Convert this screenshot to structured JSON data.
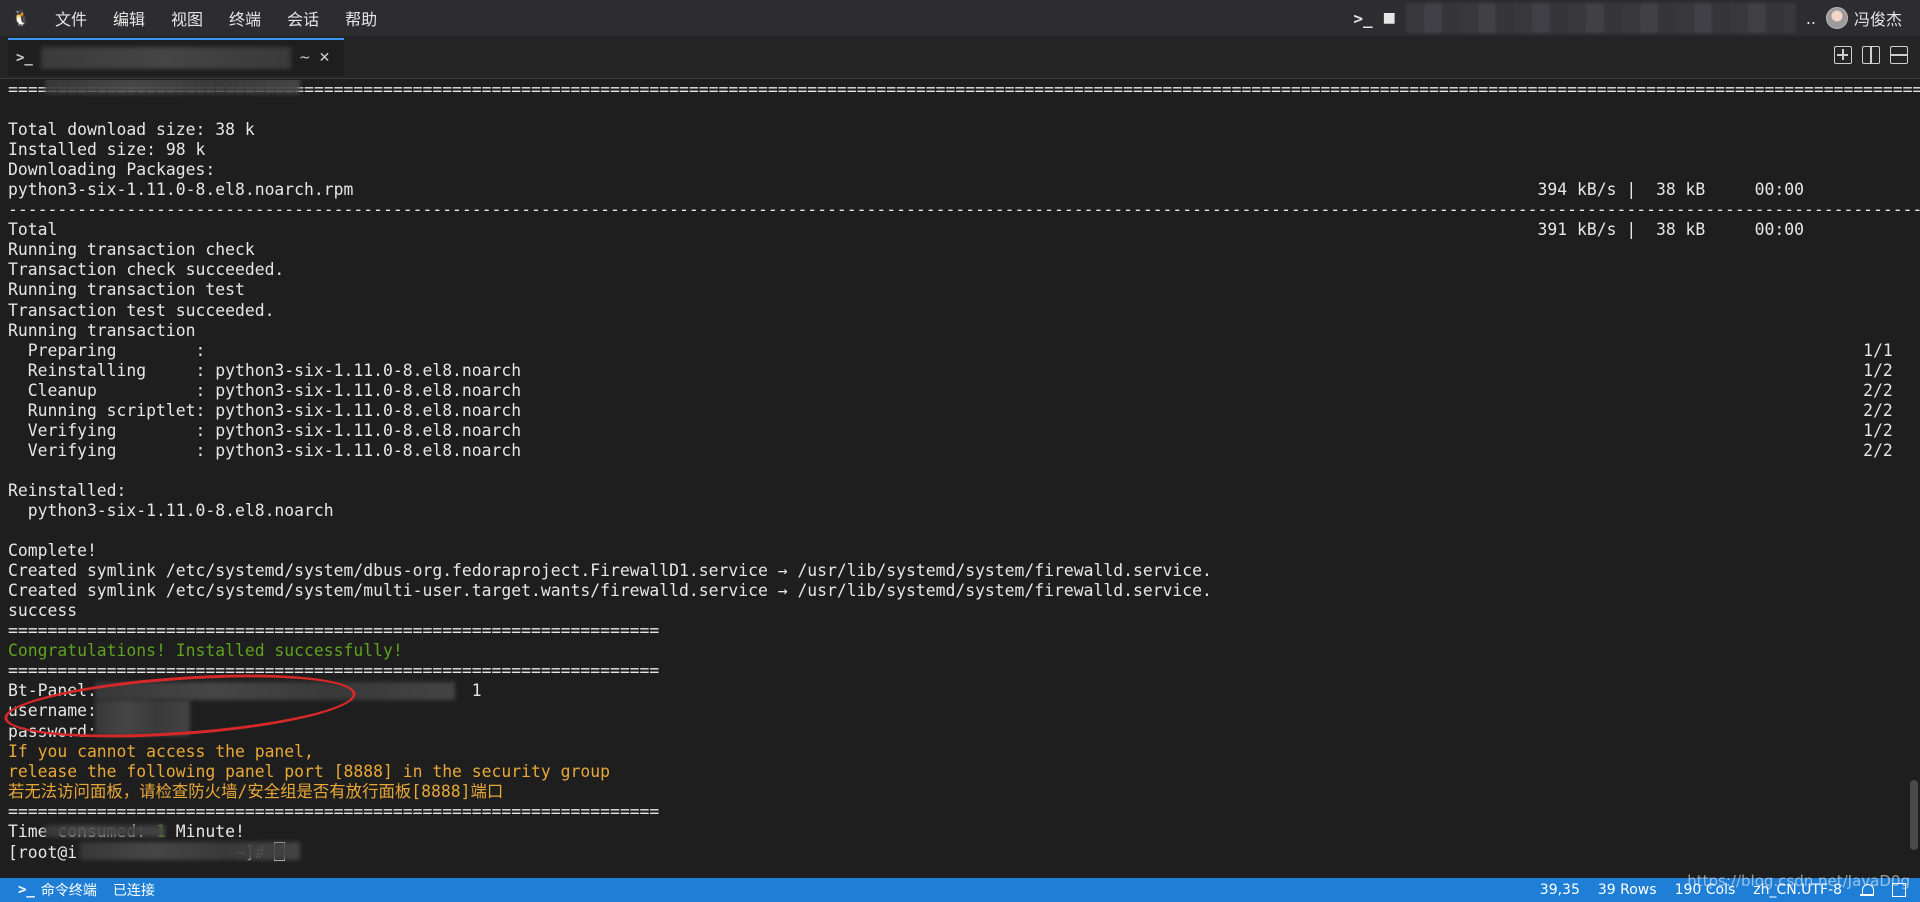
{
  "menubar": {
    "items": [
      "文件",
      "编辑",
      "视图",
      "终端",
      "会话",
      "帮助"
    ],
    "user_name": "冯俊杰",
    "ellipsis": ".."
  },
  "tab": {
    "icon": "terminal-icon",
    "suffix": "~"
  },
  "terminal": {
    "lines": [
      {
        "text": "========================================================================================================================================================================================================",
        "cls": ""
      },
      {
        "text": "",
        "cls": ""
      },
      {
        "text": "Total download size: 38 k",
        "cls": ""
      },
      {
        "text": "Installed size: 98 k",
        "cls": ""
      },
      {
        "text": "Downloading Packages:",
        "cls": ""
      },
      {
        "text": "python3-six-1.11.0-8.el8.noarch.rpm                                                                                                                        394 kB/s |  38 kB     00:00",
        "cls": ""
      },
      {
        "text": "--------------------------------------------------------------------------------------------------------------------------------------------------------------------------------------------------------",
        "cls": ""
      },
      {
        "text": "Total                                                                                                                                                      391 kB/s |  38 kB     00:00",
        "cls": ""
      },
      {
        "text": "Running transaction check",
        "cls": ""
      },
      {
        "text": "Transaction check succeeded.",
        "cls": ""
      },
      {
        "text": "Running transaction test",
        "cls": ""
      },
      {
        "text": "Transaction test succeeded.",
        "cls": ""
      },
      {
        "text": "Running transaction",
        "cls": ""
      },
      {
        "text": "  Preparing        :                                                                                                                                                                        1/1",
        "cls": ""
      },
      {
        "text": "  Reinstalling     : python3-six-1.11.0-8.el8.noarch                                                                                                                                        1/2",
        "cls": ""
      },
      {
        "text": "  Cleanup          : python3-six-1.11.0-8.el8.noarch                                                                                                                                        2/2",
        "cls": ""
      },
      {
        "text": "  Running scriptlet: python3-six-1.11.0-8.el8.noarch                                                                                                                                        2/2",
        "cls": ""
      },
      {
        "text": "  Verifying        : python3-six-1.11.0-8.el8.noarch                                                                                                                                        1/2",
        "cls": ""
      },
      {
        "text": "  Verifying        : python3-six-1.11.0-8.el8.noarch                                                                                                                                        2/2",
        "cls": ""
      },
      {
        "text": "",
        "cls": ""
      },
      {
        "text": "Reinstalled:",
        "cls": ""
      },
      {
        "text": "  python3-six-1.11.0-8.el8.noarch",
        "cls": ""
      },
      {
        "text": "",
        "cls": ""
      },
      {
        "text": "Complete!",
        "cls": ""
      },
      {
        "text": "Created symlink /etc/systemd/system/dbus-org.fedoraproject.FirewallD1.service → /usr/lib/systemd/system/firewalld.service.",
        "cls": ""
      },
      {
        "text": "Created symlink /etc/systemd/system/multi-user.target.wants/firewalld.service → /usr/lib/systemd/system/firewalld.service.",
        "cls": ""
      },
      {
        "text": "success",
        "cls": ""
      },
      {
        "text": "==================================================================",
        "cls": ""
      },
      {
        "text": "Congratulations! Installed successfully!",
        "cls": "green"
      },
      {
        "text": "==================================================================",
        "cls": ""
      },
      {
        "text": "Bt-Panel:                                      1",
        "cls": ""
      },
      {
        "text": "username:",
        "cls": ""
      },
      {
        "text": "password:",
        "cls": ""
      },
      {
        "text": "If you cannot access the panel,",
        "cls": "orange"
      },
      {
        "text": "release the following panel port [8888] in the security group",
        "cls": "orange"
      },
      {
        "text": "若无法访问面板，请检查防火墙/安全组是否有放行面板[8888]端口",
        "cls": "orange"
      },
      {
        "text": "==================================================================",
        "cls": ""
      }
    ],
    "time_prefix": "Time consumed: ",
    "time_value": "1",
    "time_suffix": " Minute!",
    "prompt_start": "[root@i",
    "prompt_end": " ~]# "
  },
  "statusbar": {
    "left_label": "命令终端",
    "connection": "已连接",
    "position": "39,35",
    "rows": "39 Rows",
    "cols": "190 Cols",
    "encoding": "zh_CN.UTF-8"
  },
  "watermark": "https://blog.csdn.net/JavaD0g"
}
